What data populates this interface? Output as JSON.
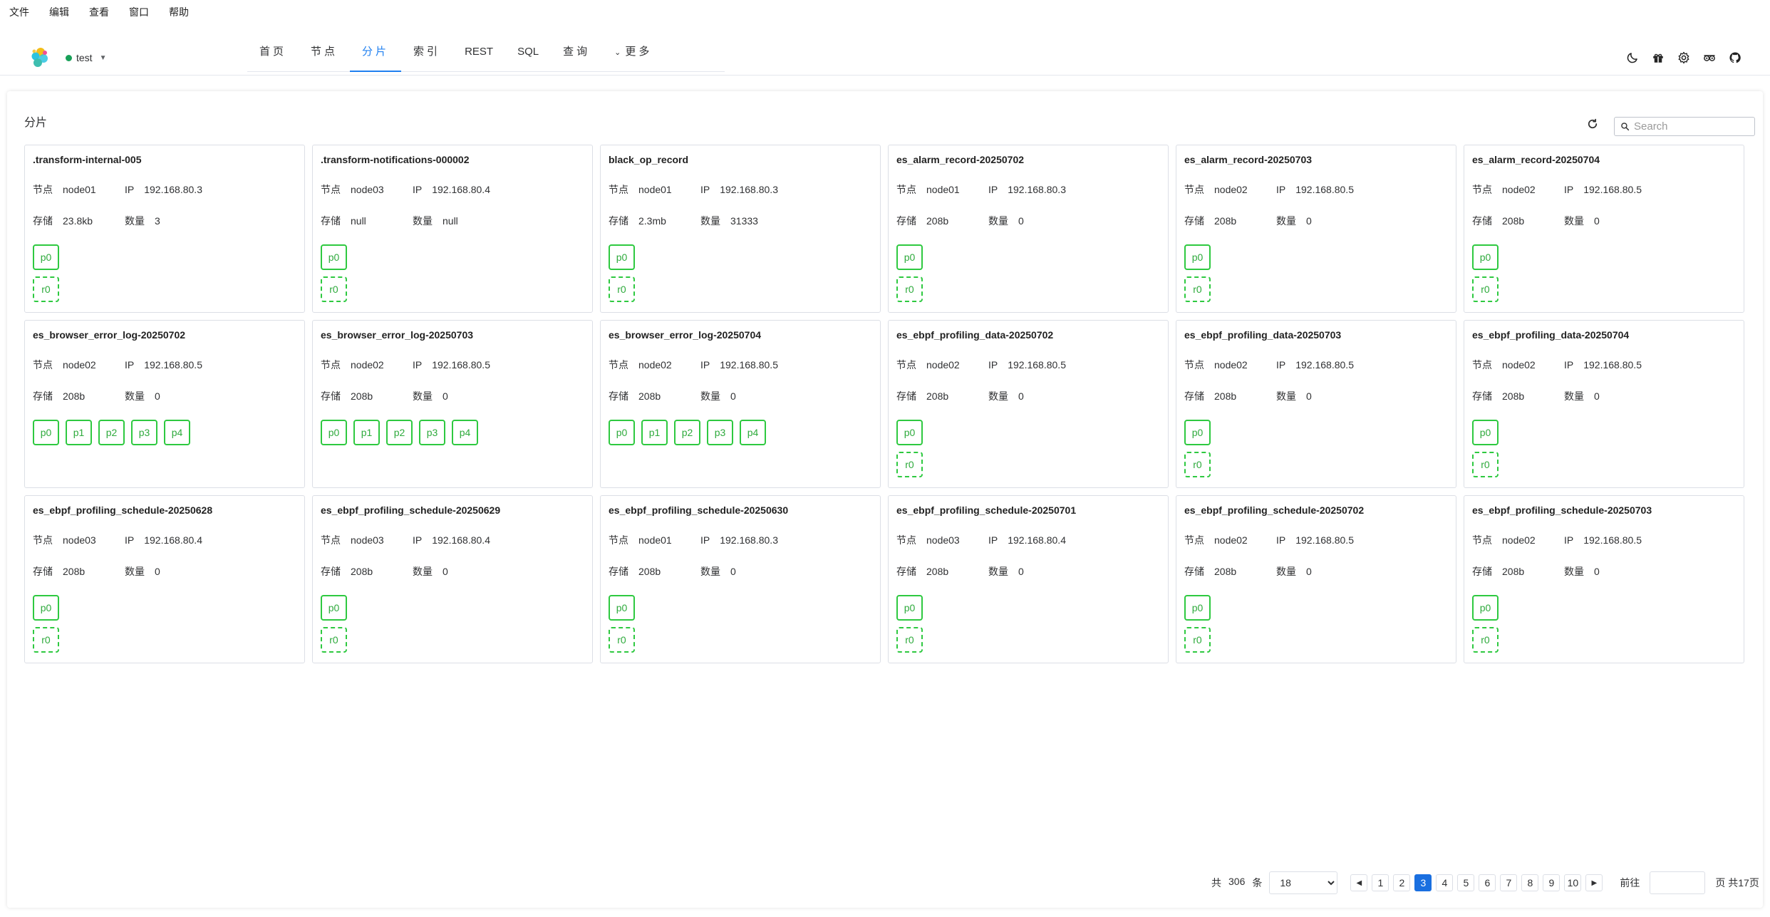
{
  "menubar": [
    "文件",
    "编辑",
    "查看",
    "窗口",
    "帮助"
  ],
  "header": {
    "cluster_name": "test",
    "cluster_status_color": "#18a058",
    "tabs": [
      {
        "label": "首页",
        "active": false
      },
      {
        "label": "节点",
        "active": false
      },
      {
        "label": "分片",
        "active": true
      },
      {
        "label": "索引",
        "active": false
      },
      {
        "label": "REST",
        "active": false
      },
      {
        "label": "SQL",
        "active": false
      },
      {
        "label": "查询",
        "active": false
      },
      {
        "label": "更多",
        "active": false
      }
    ],
    "icons": [
      "moon-icon",
      "gift-icon",
      "settings-icon",
      "tripadvisor-icon",
      "github-icon"
    ]
  },
  "main": {
    "title": "分片",
    "search_placeholder": "Search",
    "labels": {
      "node": "节点",
      "ip": "IP",
      "store": "存储",
      "docs": "数量"
    }
  },
  "cards": [
    {
      "name": ".transform-internal-005",
      "node": "node01",
      "ip": "192.168.80.3",
      "store": "23.8kb",
      "docs": "3",
      "primaries": [
        "p0"
      ],
      "replicas": [
        "r0"
      ]
    },
    {
      "name": ".transform-notifications-000002",
      "node": "node03",
      "ip": "192.168.80.4",
      "store": "null",
      "docs": "null",
      "primaries": [
        "p0"
      ],
      "replicas": [
        "r0"
      ]
    },
    {
      "name": "black_op_record",
      "node": "node01",
      "ip": "192.168.80.3",
      "store": "2.3mb",
      "docs": "31333",
      "primaries": [
        "p0"
      ],
      "replicas": [
        "r0"
      ]
    },
    {
      "name": "es_alarm_record-20250702",
      "node": "node01",
      "ip": "192.168.80.3",
      "store": "208b",
      "docs": "0",
      "primaries": [
        "p0"
      ],
      "replicas": [
        "r0"
      ]
    },
    {
      "name": "es_alarm_record-20250703",
      "node": "node02",
      "ip": "192.168.80.5",
      "store": "208b",
      "docs": "0",
      "primaries": [
        "p0"
      ],
      "replicas": [
        "r0"
      ]
    },
    {
      "name": "es_alarm_record-20250704",
      "node": "node02",
      "ip": "192.168.80.5",
      "store": "208b",
      "docs": "0",
      "primaries": [
        "p0"
      ],
      "replicas": [
        "r0"
      ]
    },
    {
      "name": "es_browser_error_log-20250702",
      "node": "node02",
      "ip": "192.168.80.5",
      "store": "208b",
      "docs": "0",
      "primaries": [
        "p0",
        "p1",
        "p2",
        "p3",
        "p4"
      ],
      "replicas": []
    },
    {
      "name": "es_browser_error_log-20250703",
      "node": "node02",
      "ip": "192.168.80.5",
      "store": "208b",
      "docs": "0",
      "primaries": [
        "p0",
        "p1",
        "p2",
        "p3",
        "p4"
      ],
      "replicas": []
    },
    {
      "name": "es_browser_error_log-20250704",
      "node": "node02",
      "ip": "192.168.80.5",
      "store": "208b",
      "docs": "0",
      "primaries": [
        "p0",
        "p1",
        "p2",
        "p3",
        "p4"
      ],
      "replicas": []
    },
    {
      "name": "es_ebpf_profiling_data-20250702",
      "node": "node02",
      "ip": "192.168.80.5",
      "store": "208b",
      "docs": "0",
      "primaries": [
        "p0"
      ],
      "replicas": [
        "r0"
      ]
    },
    {
      "name": "es_ebpf_profiling_data-20250703",
      "node": "node02",
      "ip": "192.168.80.5",
      "store": "208b",
      "docs": "0",
      "primaries": [
        "p0"
      ],
      "replicas": [
        "r0"
      ]
    },
    {
      "name": "es_ebpf_profiling_data-20250704",
      "node": "node02",
      "ip": "192.168.80.5",
      "store": "208b",
      "docs": "0",
      "primaries": [
        "p0"
      ],
      "replicas": [
        "r0"
      ]
    },
    {
      "name": "es_ebpf_profiling_schedule-20250628",
      "node": "node03",
      "ip": "192.168.80.4",
      "store": "208b",
      "docs": "0",
      "primaries": [
        "p0"
      ],
      "replicas": [
        "r0"
      ]
    },
    {
      "name": "es_ebpf_profiling_schedule-20250629",
      "node": "node03",
      "ip": "192.168.80.4",
      "store": "208b",
      "docs": "0",
      "primaries": [
        "p0"
      ],
      "replicas": [
        "r0"
      ]
    },
    {
      "name": "es_ebpf_profiling_schedule-20250630",
      "node": "node01",
      "ip": "192.168.80.3",
      "store": "208b",
      "docs": "0",
      "primaries": [
        "p0"
      ],
      "replicas": [
        "r0"
      ]
    },
    {
      "name": "es_ebpf_profiling_schedule-20250701",
      "node": "node03",
      "ip": "192.168.80.4",
      "store": "208b",
      "docs": "0",
      "primaries": [
        "p0"
      ],
      "replicas": [
        "r0"
      ]
    },
    {
      "name": "es_ebpf_profiling_schedule-20250702",
      "node": "node02",
      "ip": "192.168.80.5",
      "store": "208b",
      "docs": "0",
      "primaries": [
        "p0"
      ],
      "replicas": [
        "r0"
      ]
    },
    {
      "name": "es_ebpf_profiling_schedule-20250703",
      "node": "node02",
      "ip": "192.168.80.5",
      "store": "208b",
      "docs": "0",
      "primaries": [
        "p0"
      ],
      "replicas": [
        "r0"
      ]
    }
  ],
  "pagination": {
    "total_prefix": "共",
    "total": "306",
    "total_suffix": "条",
    "page_size": "18",
    "pages": [
      "1",
      "2",
      "3",
      "4",
      "5",
      "6",
      "7",
      "8",
      "9",
      "10"
    ],
    "current_page": "3",
    "goto_label": "前往",
    "goto_suffix": "页 共17页"
  },
  "colors": {
    "accent": "#2080f0",
    "shard_border": "#2ec940",
    "active_page": "#1a6fe0"
  }
}
